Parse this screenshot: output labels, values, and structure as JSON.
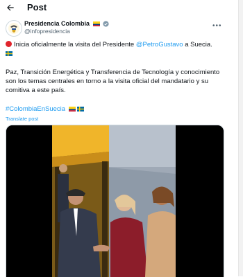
{
  "header": {
    "title": "Post"
  },
  "author": {
    "name": "Presidencia Colombia",
    "handle": "@infopresidencia"
  },
  "tweet": {
    "line1_pre": "Inicia oficialmente la visita del Presidente ",
    "line1_mention": "@PetroGustavo",
    "line1_post": " a Suecia.",
    "paragraph": "Paz, Transición Energética y Transferencia de Tecnología y conocimiento son los temas centrales en torno a la visita oficial del mandatario y su comitiva a este país.",
    "hashtag": "#ColombiaEnSuecia",
    "translate_label": "Translate post"
  },
  "icons": {
    "back": "arrow-left-icon",
    "verified": "verified-badge-icon",
    "more": "more-horizontal-icon"
  },
  "colors": {
    "link": "#1d9bf0",
    "text": "#0f1419",
    "secondary": "#536471"
  }
}
